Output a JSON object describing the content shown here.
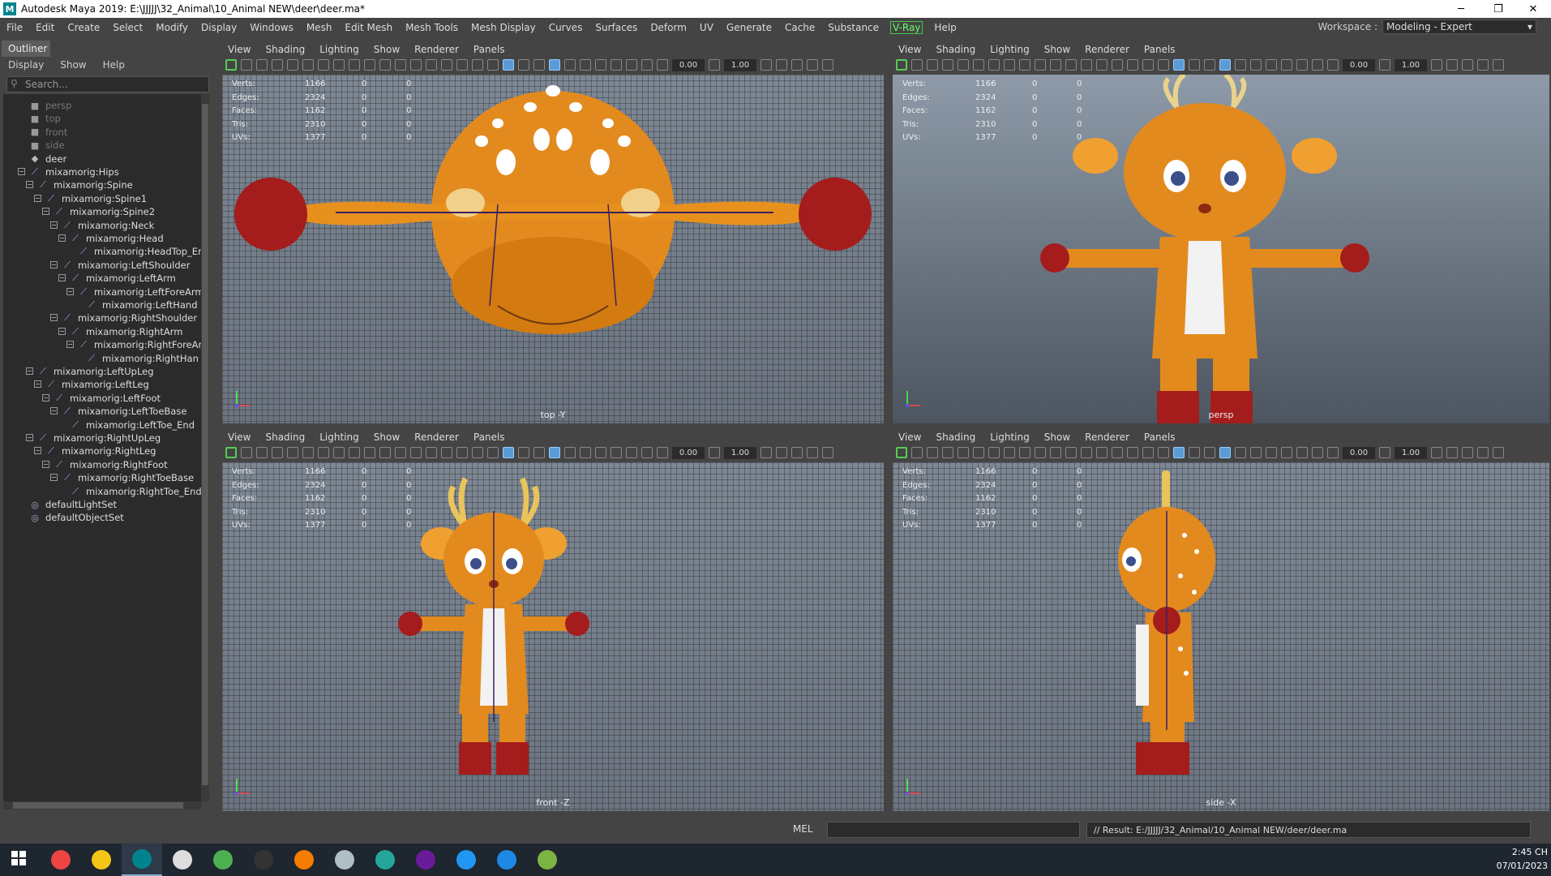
{
  "window": {
    "title": "Autodesk Maya 2019: E:\\JJJJJ\\32_Animal\\10_Animal NEW\\deer\\deer.ma*",
    "logo": "M",
    "minimize": "─",
    "restore": "❐",
    "close": "✕"
  },
  "menubar": [
    "File",
    "Edit",
    "Create",
    "Select",
    "Modify",
    "Display",
    "Windows",
    "Mesh",
    "Edit Mesh",
    "Mesh Tools",
    "Mesh Display",
    "Curves",
    "Surfaces",
    "Deform",
    "UV",
    "Generate",
    "Cache",
    "Substance"
  ],
  "menubar_vray": "V-Ray",
  "menubar_help": "Help",
  "workspace": {
    "label": "Workspace :",
    "value": "Modeling - Expert"
  },
  "outliner": {
    "tab": "Outliner",
    "menu": [
      "Display",
      "Show",
      "Help"
    ],
    "search_placeholder": "Search...",
    "items": [
      {
        "label": "persp",
        "kind": "camera",
        "depth": 0,
        "dim": true
      },
      {
        "label": "top",
        "kind": "camera",
        "depth": 0,
        "dim": true
      },
      {
        "label": "front",
        "kind": "camera",
        "depth": 0,
        "dim": true
      },
      {
        "label": "side",
        "kind": "camera",
        "depth": 0,
        "dim": true
      },
      {
        "label": "deer",
        "kind": "mesh",
        "depth": 0
      },
      {
        "label": "mixamorig:Hips",
        "kind": "joint",
        "depth": 0,
        "expand": true
      },
      {
        "label": "mixamorig:Spine",
        "kind": "joint",
        "depth": 1,
        "expand": true
      },
      {
        "label": "mixamorig:Spine1",
        "kind": "joint",
        "depth": 2,
        "expand": true
      },
      {
        "label": "mixamorig:Spine2",
        "kind": "joint",
        "depth": 3,
        "expand": true
      },
      {
        "label": "mixamorig:Neck",
        "kind": "joint",
        "depth": 4,
        "expand": true
      },
      {
        "label": "mixamorig:Head",
        "kind": "joint",
        "depth": 5,
        "expand": true
      },
      {
        "label": "mixamorig:HeadTop_Er",
        "kind": "joint",
        "depth": 6
      },
      {
        "label": "mixamorig:LeftShoulder",
        "kind": "joint",
        "depth": 4,
        "expand": true
      },
      {
        "label": "mixamorig:LeftArm",
        "kind": "joint",
        "depth": 5,
        "expand": true
      },
      {
        "label": "mixamorig:LeftForeArm",
        "kind": "joint",
        "depth": 6,
        "expand": true
      },
      {
        "label": "mixamorig:LeftHand",
        "kind": "joint",
        "depth": 7
      },
      {
        "label": "mixamorig:RightShoulder",
        "kind": "joint",
        "depth": 4,
        "expand": true
      },
      {
        "label": "mixamorig:RightArm",
        "kind": "joint",
        "depth": 5,
        "expand": true
      },
      {
        "label": "mixamorig:RightForeAr",
        "kind": "joint",
        "depth": 6,
        "expand": true
      },
      {
        "label": "mixamorig:RightHan",
        "kind": "joint",
        "depth": 7
      },
      {
        "label": "mixamorig:LeftUpLeg",
        "kind": "joint",
        "depth": 1,
        "expand": true
      },
      {
        "label": "mixamorig:LeftLeg",
        "kind": "joint",
        "depth": 2,
        "expand": true
      },
      {
        "label": "mixamorig:LeftFoot",
        "kind": "joint",
        "depth": 3,
        "expand": true
      },
      {
        "label": "mixamorig:LeftToeBase",
        "kind": "joint",
        "depth": 4,
        "expand": true
      },
      {
        "label": "mixamorig:LeftToe_End",
        "kind": "joint",
        "depth": 5
      },
      {
        "label": "mixamorig:RightUpLeg",
        "kind": "joint",
        "depth": 1,
        "expand": true
      },
      {
        "label": "mixamorig:RightLeg",
        "kind": "joint",
        "depth": 2,
        "expand": true
      },
      {
        "label": "mixamorig:RightFoot",
        "kind": "joint",
        "depth": 3,
        "expand": true
      },
      {
        "label": "mixamorig:RightToeBase",
        "kind": "joint",
        "depth": 4,
        "expand": true
      },
      {
        "label": "mixamorig:RightToe_End",
        "kind": "joint",
        "depth": 5
      },
      {
        "label": "defaultLightSet",
        "kind": "set",
        "depth": 0
      },
      {
        "label": "defaultObjectSet",
        "kind": "set",
        "depth": 0
      }
    ]
  },
  "viewport_menu": [
    "View",
    "Shading",
    "Lighting",
    "Show",
    "Renderer",
    "Panels"
  ],
  "viewport_fields": [
    "0.00",
    "1.00"
  ],
  "hud": [
    {
      "k": "Verts:",
      "v1": "1166",
      "v2": "0",
      "v3": "0"
    },
    {
      "k": "Edges:",
      "v1": "2324",
      "v2": "0",
      "v3": "0"
    },
    {
      "k": "Faces:",
      "v1": "1162",
      "v2": "0",
      "v3": "0"
    },
    {
      "k": "Tris:",
      "v1": "2310",
      "v2": "0",
      "v3": "0"
    },
    {
      "k": "UVs:",
      "v1": "1377",
      "v2": "0",
      "v3": "0"
    }
  ],
  "viewports": {
    "top": {
      "label": "top -Y"
    },
    "persp": {
      "label": "persp"
    },
    "front": {
      "label": "front -Z"
    },
    "side": {
      "label": "side -X"
    }
  },
  "commandline": {
    "lang": "MEL",
    "result": "// Result: E:/JJJJJ/32_Animal/10_Animal NEW/deer/deer.ma"
  },
  "clock": {
    "time": "2:45 CH",
    "date": "07/01/2023"
  },
  "taskbar": [
    "windows-start",
    "avast",
    "file-explorer",
    "maya",
    "photo-app",
    "chrome",
    "unity",
    "blender",
    "app-bird",
    "upwork",
    "github",
    "app-w",
    "zalo",
    "app-green"
  ]
}
